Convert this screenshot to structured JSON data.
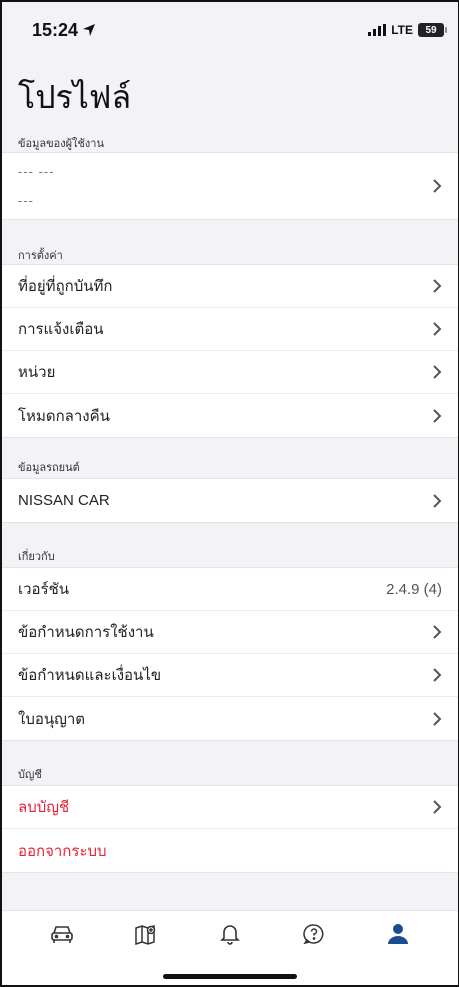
{
  "status": {
    "time": "15:24",
    "network": "LTE",
    "battery": "59"
  },
  "page_title": "โปรไฟล์",
  "sections": {
    "user": {
      "header": "ข้อมูลของผู้ใช้งาน",
      "first_name": "--- ---",
      "last_name": "---"
    },
    "settings": {
      "header": "การตั้งค่า",
      "items": [
        {
          "label": "ที่อยู่ที่ถูกบันทึก"
        },
        {
          "label": "การแจ้งเตือน"
        },
        {
          "label": "หน่วย"
        },
        {
          "label": "โหมดกลางคืน"
        }
      ]
    },
    "vehicle": {
      "header": "ข้อมูลรถยนต์",
      "items": [
        {
          "label": "NISSAN CAR"
        }
      ]
    },
    "about": {
      "header": "เกี่ยวกับ",
      "version_label": "เวอร์ชัน",
      "version_value": "2.4.9 (4)",
      "items": [
        {
          "label": "ข้อกำหนดการใช้งาน"
        },
        {
          "label": "ข้อกำหนดและเงื่อนไข"
        },
        {
          "label": "ใบอนุญาต"
        }
      ]
    },
    "account": {
      "header": "บัญชี",
      "delete_label": "ลบบัญชี",
      "logout_label": "ออกจากระบบ",
      "danger_color": "#e5233b"
    }
  },
  "tabbar": {
    "active_color": "#1a4d8f",
    "inactive_color": "#333333",
    "tabs": [
      {
        "icon": "car-icon"
      },
      {
        "icon": "map-icon"
      },
      {
        "icon": "bell-icon"
      },
      {
        "icon": "help-icon"
      },
      {
        "icon": "profile-icon"
      }
    ]
  }
}
